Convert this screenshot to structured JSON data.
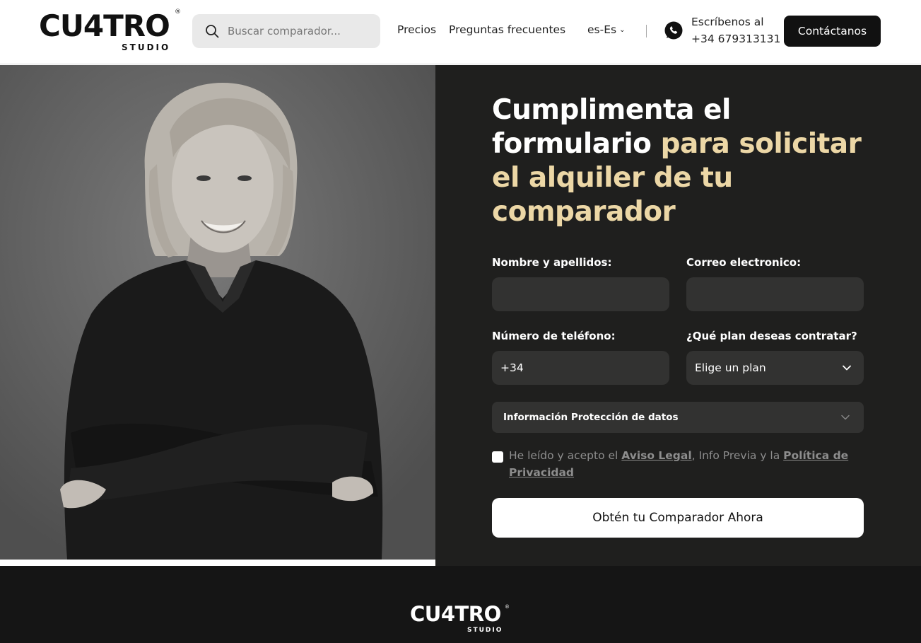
{
  "header": {
    "logo_main": "CU4TRO",
    "logo_registered": "®",
    "logo_sub": "STUDIO",
    "search_placeholder": "Buscar comparador...",
    "nav": [
      "Precios",
      "Preguntas frecuentes"
    ],
    "language": "es-Es",
    "whatsapp_line1": "Escríbenos al",
    "whatsapp_line2": "+34 679313131",
    "contact_button": "Contáctanos"
  },
  "form": {
    "headline_white": "Cumplimenta el formulario ",
    "headline_accent": "para solicitar el alquiler de tu comparador",
    "name_label": "Nombre y apellidos:",
    "name_value": "",
    "email_label": "Correo electronico:",
    "email_value": "",
    "phone_label": "Número de teléfono:",
    "phone_value": "+34",
    "plan_label": "¿Qué plan deseas contratar?",
    "plan_selected": "Elige un plan",
    "privacy_accordion": "Información Protección de datos",
    "consent_prefix": "He leído y acepto el ",
    "consent_link1": "Aviso Legal",
    "consent_middle": ", Info Previa y la ",
    "consent_link2": "Política de Privacidad",
    "consent_checked": false,
    "submit_button": "Obtén tu Comparador Ahora"
  },
  "footer": {
    "logo_main": "CU4TRO",
    "logo_registered": "®",
    "logo_sub": "STUDIO"
  },
  "colors": {
    "accent": "#ecd7a6",
    "form_bg": "#1f1f1e",
    "field_bg": "#323231",
    "footer_bg": "#151515",
    "button_dark": "#111111"
  },
  "icons": [
    "search-icon",
    "chevron-down-icon",
    "whatsapp-icon"
  ]
}
